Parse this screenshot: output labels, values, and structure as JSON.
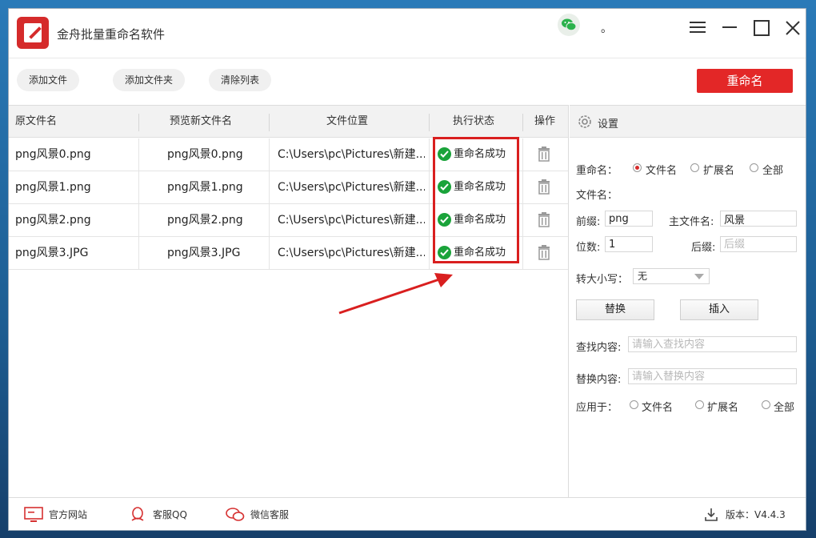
{
  "app": {
    "title": "金舟批量重命名软件",
    "status_dot": "。"
  },
  "toolbar": {
    "add_file": "添加文件",
    "add_folder": "添加文件夹",
    "clear_list": "清除列表",
    "rename": "重命名"
  },
  "table": {
    "columns": [
      "原文件名",
      "预览新文件名",
      "文件位置",
      "执行状态",
      "操作"
    ],
    "rows": [
      {
        "original": "png风景0.png",
        "preview": "png风景0.png",
        "location": "C:\\Users\\pc\\Pictures\\新建...",
        "status": "重命名成功"
      },
      {
        "original": "png风景1.png",
        "preview": "png风景1.png",
        "location": "C:\\Users\\pc\\Pictures\\新建...",
        "status": "重命名成功"
      },
      {
        "original": "png风景2.png",
        "preview": "png风景2.png",
        "location": "C:\\Users\\pc\\Pictures\\新建...",
        "status": "重命名成功"
      },
      {
        "original": "png风景3.JPG",
        "preview": "png风景3.JPG",
        "location": "C:\\Users\\pc\\Pictures\\新建...",
        "status": "重命名成功"
      }
    ]
  },
  "settings": {
    "title": "设置",
    "rename_label": "重命名：",
    "rename_options": [
      "文件名",
      "扩展名",
      "全部"
    ],
    "rename_selected": "文件名",
    "filename_label": "文件名：",
    "prefix_label": "前缀:",
    "prefix_value": "png",
    "main_name_label": "主文件名:",
    "main_name_value": "风景",
    "digits_label": "位数:",
    "digits_value": "1",
    "suffix_label": "后缀:",
    "suffix_placeholder": "后缀",
    "case_label": "转大小写：",
    "case_value": "无",
    "replace_button": "替换",
    "insert_button": "插入",
    "find_label": "查找内容:",
    "find_placeholder": "请输入查找内容",
    "replace_label": "替换内容:",
    "replace_placeholder": "请输入替换内容",
    "apply_label": "应用于：",
    "apply_options": [
      "文件名",
      "扩展名",
      "全部"
    ]
  },
  "footer": {
    "website": "官方网站",
    "qq": "客服QQ",
    "wechat": "微信客服",
    "version": "版本：V4.4.3"
  },
  "colors": {
    "accent_red": "#e32727",
    "success_green": "#1aa33a"
  }
}
